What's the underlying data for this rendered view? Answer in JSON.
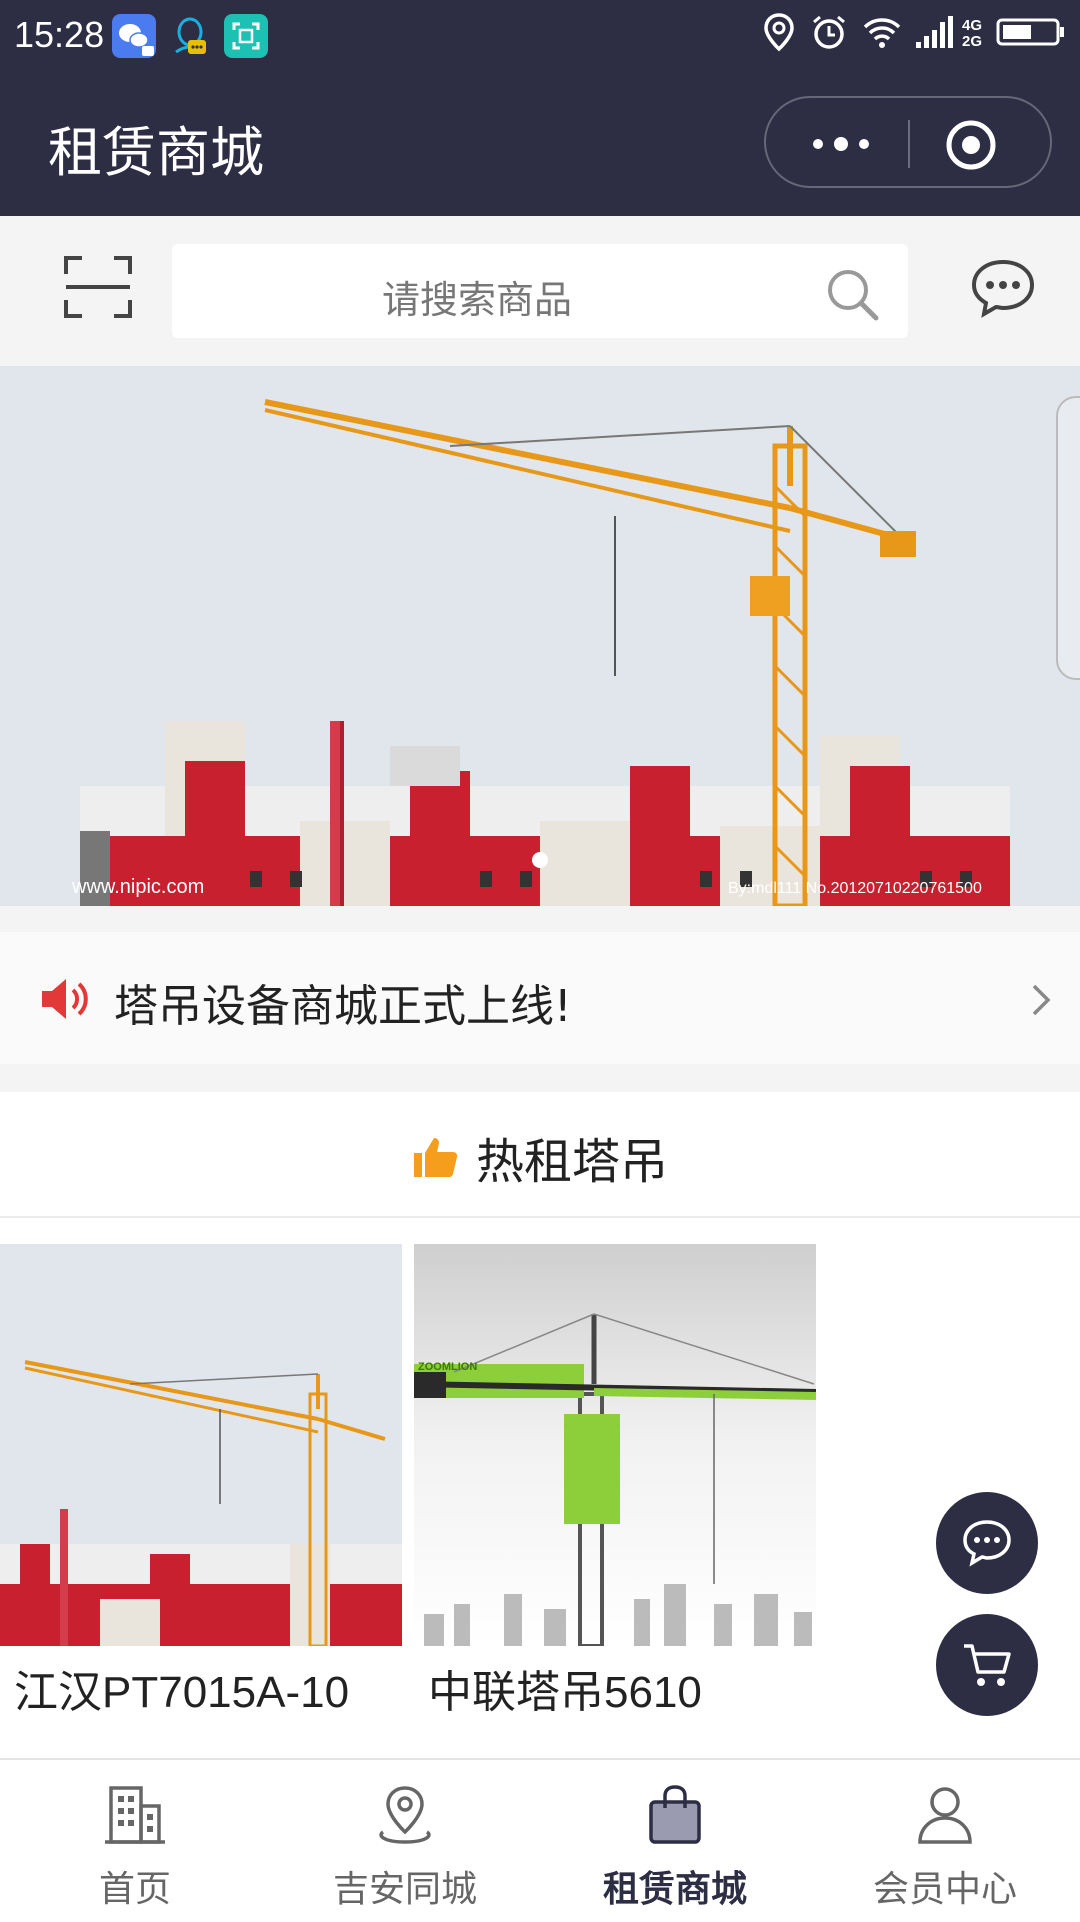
{
  "status_bar": {
    "time": "15:28",
    "network": [
      "4G",
      "2G"
    ],
    "apps": [
      "wechat-icon",
      "qq-icon",
      "scanner-app-icon"
    ]
  },
  "header": {
    "title": "租赁商城"
  },
  "search": {
    "placeholder": "请搜索商品"
  },
  "banner": {
    "watermark_left": "www.nipic.com",
    "watermark_right": "By:mdl111 No.20120710220761500"
  },
  "notice": {
    "text": "塔吊设备商城正式上线!"
  },
  "hot_section": {
    "title": "热租塔吊"
  },
  "products": [
    {
      "name": "江汉PT7015A-10"
    },
    {
      "name": "中联塔吊5610",
      "brand_text": "ZOOMLION"
    }
  ],
  "tabbar": {
    "items": [
      {
        "label": "首页",
        "icon": "building-icon"
      },
      {
        "label": "吉安同城",
        "icon": "location-pin-icon"
      },
      {
        "label": "租赁商城",
        "icon": "shopping-bag-icon",
        "active": true
      },
      {
        "label": "会员中心",
        "icon": "user-icon"
      }
    ]
  },
  "colors": {
    "primary_dark": "#2d2d44",
    "accent_orange": "#f59d1c",
    "notice_red": "#e23838"
  }
}
